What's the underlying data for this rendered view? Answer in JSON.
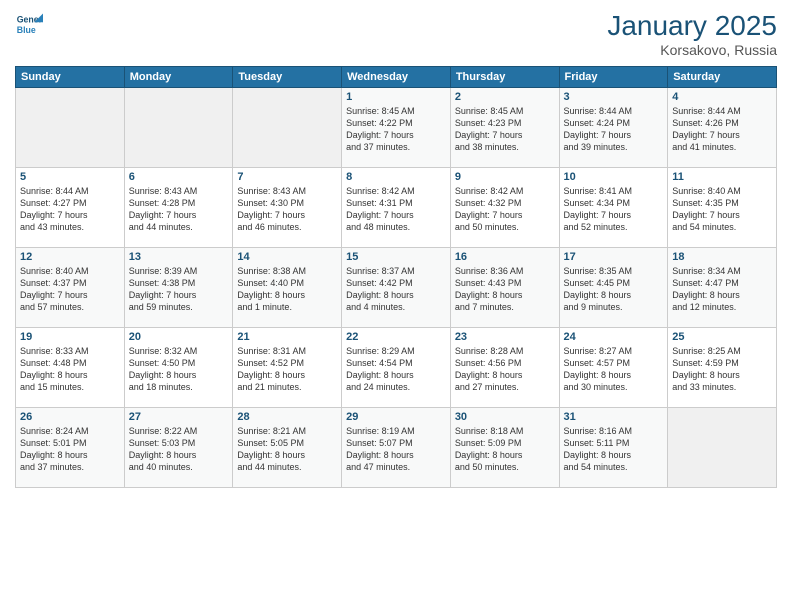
{
  "logo": {
    "line1": "General",
    "line2": "Blue"
  },
  "title": "January 2025",
  "location": "Korsakovo, Russia",
  "days_of_week": [
    "Sunday",
    "Monday",
    "Tuesday",
    "Wednesday",
    "Thursday",
    "Friday",
    "Saturday"
  ],
  "weeks": [
    [
      {
        "day": "",
        "info": ""
      },
      {
        "day": "",
        "info": ""
      },
      {
        "day": "",
        "info": ""
      },
      {
        "day": "1",
        "info": "Sunrise: 8:45 AM\nSunset: 4:22 PM\nDaylight: 7 hours\nand 37 minutes."
      },
      {
        "day": "2",
        "info": "Sunrise: 8:45 AM\nSunset: 4:23 PM\nDaylight: 7 hours\nand 38 minutes."
      },
      {
        "day": "3",
        "info": "Sunrise: 8:44 AM\nSunset: 4:24 PM\nDaylight: 7 hours\nand 39 minutes."
      },
      {
        "day": "4",
        "info": "Sunrise: 8:44 AM\nSunset: 4:26 PM\nDaylight: 7 hours\nand 41 minutes."
      }
    ],
    [
      {
        "day": "5",
        "info": "Sunrise: 8:44 AM\nSunset: 4:27 PM\nDaylight: 7 hours\nand 43 minutes."
      },
      {
        "day": "6",
        "info": "Sunrise: 8:43 AM\nSunset: 4:28 PM\nDaylight: 7 hours\nand 44 minutes."
      },
      {
        "day": "7",
        "info": "Sunrise: 8:43 AM\nSunset: 4:30 PM\nDaylight: 7 hours\nand 46 minutes."
      },
      {
        "day": "8",
        "info": "Sunrise: 8:42 AM\nSunset: 4:31 PM\nDaylight: 7 hours\nand 48 minutes."
      },
      {
        "day": "9",
        "info": "Sunrise: 8:42 AM\nSunset: 4:32 PM\nDaylight: 7 hours\nand 50 minutes."
      },
      {
        "day": "10",
        "info": "Sunrise: 8:41 AM\nSunset: 4:34 PM\nDaylight: 7 hours\nand 52 minutes."
      },
      {
        "day": "11",
        "info": "Sunrise: 8:40 AM\nSunset: 4:35 PM\nDaylight: 7 hours\nand 54 minutes."
      }
    ],
    [
      {
        "day": "12",
        "info": "Sunrise: 8:40 AM\nSunset: 4:37 PM\nDaylight: 7 hours\nand 57 minutes."
      },
      {
        "day": "13",
        "info": "Sunrise: 8:39 AM\nSunset: 4:38 PM\nDaylight: 7 hours\nand 59 minutes."
      },
      {
        "day": "14",
        "info": "Sunrise: 8:38 AM\nSunset: 4:40 PM\nDaylight: 8 hours\nand 1 minute."
      },
      {
        "day": "15",
        "info": "Sunrise: 8:37 AM\nSunset: 4:42 PM\nDaylight: 8 hours\nand 4 minutes."
      },
      {
        "day": "16",
        "info": "Sunrise: 8:36 AM\nSunset: 4:43 PM\nDaylight: 8 hours\nand 7 minutes."
      },
      {
        "day": "17",
        "info": "Sunrise: 8:35 AM\nSunset: 4:45 PM\nDaylight: 8 hours\nand 9 minutes."
      },
      {
        "day": "18",
        "info": "Sunrise: 8:34 AM\nSunset: 4:47 PM\nDaylight: 8 hours\nand 12 minutes."
      }
    ],
    [
      {
        "day": "19",
        "info": "Sunrise: 8:33 AM\nSunset: 4:48 PM\nDaylight: 8 hours\nand 15 minutes."
      },
      {
        "day": "20",
        "info": "Sunrise: 8:32 AM\nSunset: 4:50 PM\nDaylight: 8 hours\nand 18 minutes."
      },
      {
        "day": "21",
        "info": "Sunrise: 8:31 AM\nSunset: 4:52 PM\nDaylight: 8 hours\nand 21 minutes."
      },
      {
        "day": "22",
        "info": "Sunrise: 8:29 AM\nSunset: 4:54 PM\nDaylight: 8 hours\nand 24 minutes."
      },
      {
        "day": "23",
        "info": "Sunrise: 8:28 AM\nSunset: 4:56 PM\nDaylight: 8 hours\nand 27 minutes."
      },
      {
        "day": "24",
        "info": "Sunrise: 8:27 AM\nSunset: 4:57 PM\nDaylight: 8 hours\nand 30 minutes."
      },
      {
        "day": "25",
        "info": "Sunrise: 8:25 AM\nSunset: 4:59 PM\nDaylight: 8 hours\nand 33 minutes."
      }
    ],
    [
      {
        "day": "26",
        "info": "Sunrise: 8:24 AM\nSunset: 5:01 PM\nDaylight: 8 hours\nand 37 minutes."
      },
      {
        "day": "27",
        "info": "Sunrise: 8:22 AM\nSunset: 5:03 PM\nDaylight: 8 hours\nand 40 minutes."
      },
      {
        "day": "28",
        "info": "Sunrise: 8:21 AM\nSunset: 5:05 PM\nDaylight: 8 hours\nand 44 minutes."
      },
      {
        "day": "29",
        "info": "Sunrise: 8:19 AM\nSunset: 5:07 PM\nDaylight: 8 hours\nand 47 minutes."
      },
      {
        "day": "30",
        "info": "Sunrise: 8:18 AM\nSunset: 5:09 PM\nDaylight: 8 hours\nand 50 minutes."
      },
      {
        "day": "31",
        "info": "Sunrise: 8:16 AM\nSunset: 5:11 PM\nDaylight: 8 hours\nand 54 minutes."
      },
      {
        "day": "",
        "info": ""
      }
    ]
  ]
}
